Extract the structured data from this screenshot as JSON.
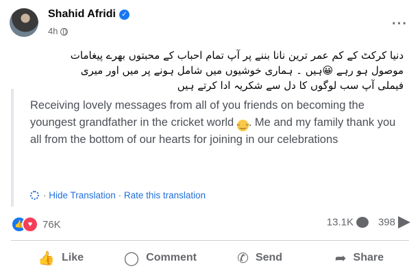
{
  "post": {
    "author": "Shahid Afridi",
    "time": "4h",
    "urdu_lines": [
      "دنیا کرکٹ کے کم عمر ترین نانا بننے پر آپ تمام احباب کے محبتوں بھرے پیغامات",
      "موصول ہو رہے 😀ہیں ۔ ہماری خوشیوں میں شامل ہونے پر میں اور میری",
      "فیملی آپ سب لوگوں کا دل سے شکریہ ادا کرتے ہیں"
    ],
    "translation_before_emoji": "Receiving lovely messages from all of you friends on becoming the youngest grandfather in the cricket world",
    "translation_after_emoji": ". Me and my family thank you all from the bottom of our hearts for joining in our celebrations",
    "hide_translation": "Hide Translation",
    "separator": "·",
    "rate_translation": "Rate this translation"
  },
  "stats": {
    "reactions": "76K",
    "comments": "13.1K",
    "shares": "398"
  },
  "actions": {
    "like": "Like",
    "comment": "Comment",
    "send": "Send",
    "share": "Share"
  },
  "icons": [
    "verified-icon",
    "globe-icon",
    "more-icon",
    "emoji-icon",
    "translate-gear-icon",
    "like-reaction-icon",
    "love-reaction-icon",
    "comment-icon",
    "share-icon",
    "thumbs-up-icon",
    "whatsapp-icon"
  ],
  "colors": {
    "accent": "#1877f2",
    "link": "#216fdb",
    "muted": "#65676b",
    "love": "#f33e58"
  }
}
